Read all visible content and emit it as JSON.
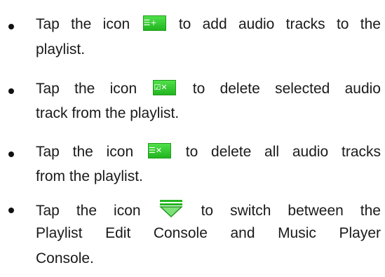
{
  "items": [
    {
      "lines": [
        {
          "before": "Tap the icon",
          "icon": "add-tracks-icon",
          "after": "to add audio tracks to the"
        },
        {
          "text": "playlist."
        }
      ]
    },
    {
      "lines": [
        {
          "before": "Tap the icon",
          "icon": "delete-selected-icon",
          "after": "to delete selected audio"
        },
        {
          "text": "track from the playlist."
        }
      ]
    },
    {
      "lines": [
        {
          "before": "Tap the icon",
          "icon": "delete-all-icon",
          "after": "to delete all audio tracks"
        },
        {
          "text": "from the playlist."
        }
      ]
    },
    {
      "lines": [
        {
          "before": "Tap the icon",
          "icon": "switch-console-icon",
          "after": "to switch between the"
        },
        {
          "text": "Playlist Edit Console and Music Player"
        },
        {
          "text": "Console."
        }
      ]
    }
  ],
  "icon_colors": {
    "green_top": "#4fe04a",
    "green_bottom": "#22b51f",
    "triangle_fill": "#7fe07a"
  }
}
